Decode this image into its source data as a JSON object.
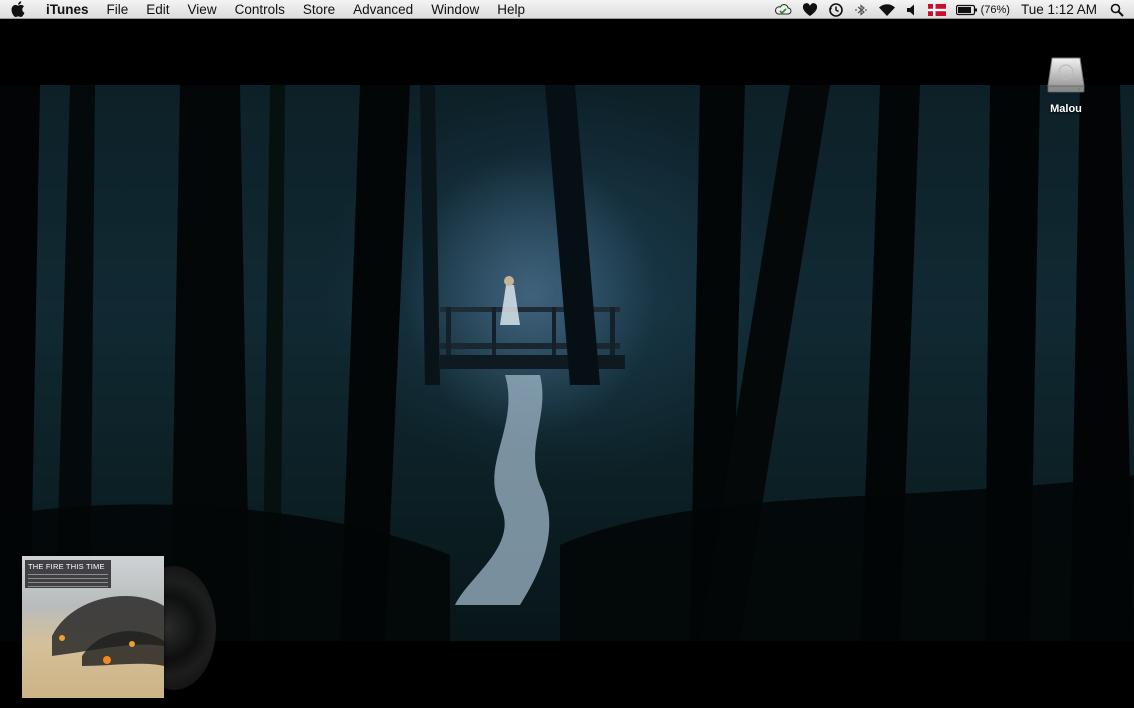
{
  "menubar": {
    "app_name": "iTunes",
    "items": [
      "File",
      "Edit",
      "View",
      "Controls",
      "Store",
      "Advanced",
      "Window",
      "Help"
    ],
    "battery_percent": "(76%)",
    "clock": "Tue 1:12 AM",
    "status_icons": [
      "cloud-sync-icon",
      "heart-icon",
      "time-machine-icon",
      "bluetooth-icon",
      "wifi-icon",
      "volume-icon",
      "flag-denmark-icon",
      "battery-icon",
      "spotlight-icon"
    ]
  },
  "desktop": {
    "icons": [
      {
        "label": "Malou",
        "icon": "hard-drive-icon"
      }
    ]
  },
  "now_playing": {
    "album_title": "THE FIRE THIS TIME"
  },
  "colors": {
    "menubar_bg": "#e6e6e6",
    "desktop_bg": "#000000",
    "flag_red": "#c8102e"
  }
}
